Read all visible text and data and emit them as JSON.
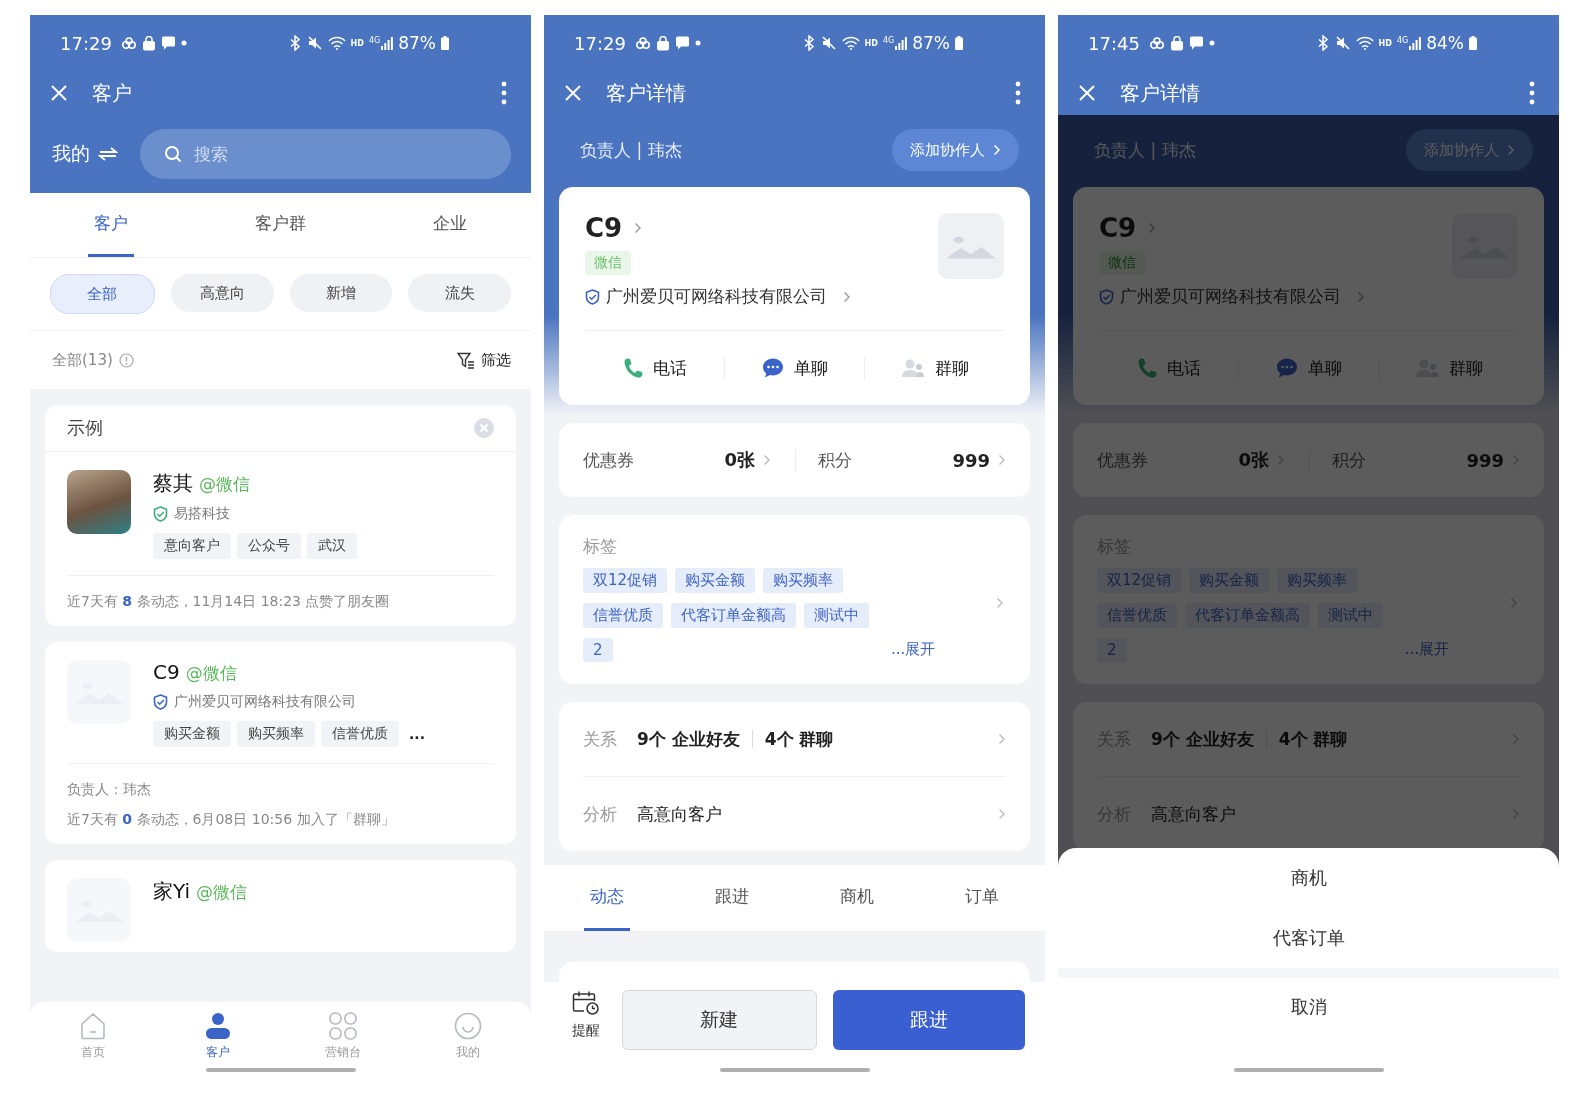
{
  "screens": [
    {
      "kind": "list",
      "status": {
        "time": "17:29",
        "network": "HD",
        "signal": "4G",
        "battery": "87%"
      },
      "title": "客户",
      "scope": "我的",
      "search": {
        "placeholder": "搜索"
      },
      "tabs": [
        {
          "label": "客户",
          "selected": true
        },
        {
          "label": "客户群",
          "selected": false
        },
        {
          "label": "企业",
          "selected": false
        }
      ],
      "chips": [
        {
          "label": "全部",
          "selected": true
        },
        {
          "label": "高意向",
          "selected": false
        },
        {
          "label": "新增",
          "selected": false
        },
        {
          "label": "流失",
          "selected": false
        }
      ],
      "summary": {
        "count": "全部(13)",
        "filter": "筛选"
      },
      "customers": [
        {
          "header": "示例",
          "kind": "photo",
          "name": "蔡其",
          "channel": "@微信",
          "company": "易搭科技",
          "color": "#3bb07c",
          "tags": [
            "意向客户",
            "公众号",
            "武汉"
          ],
          "activity": {
            "prefix": "近7天有",
            "count": "8",
            "suffix": "条动态，11月14日 18:23 点赞了朋友圈"
          }
        },
        {
          "kind": "placeholder",
          "name": "C9",
          "channel": "@微信",
          "company": "广州爱贝可网络科技有限公司",
          "color": "#3a64c8",
          "tags": [
            "购买金额",
            "购买频率",
            "信誉优质"
          ],
          "overflow": "...",
          "owner": "负责人：玮杰",
          "activity": {
            "prefix": "近7天有",
            "count": "0",
            "suffix": "条动态，6月08日 10:56  加入了「群聊」"
          }
        },
        {
          "kind": "placeholder",
          "name": "家Yi",
          "channel": "@微信"
        }
      ],
      "nav": [
        {
          "label": "首页",
          "selected": false
        },
        {
          "label": "客户",
          "selected": true
        },
        {
          "label": "营销台",
          "selected": false
        },
        {
          "label": "我的",
          "selected": false
        }
      ]
    },
    {
      "kind": "detail",
      "dimmed": false,
      "status": {
        "time": "17:29",
        "network": "HD",
        "signal": "4G",
        "battery": "87%"
      },
      "title": "客户详情",
      "owner": "负责人 | 玮杰",
      "add_button": "添加协作人",
      "customer": {
        "name": "C9",
        "channel": "微信",
        "company": "广州爱贝可网络科技有限公司"
      },
      "actions": [
        {
          "label": "电话"
        },
        {
          "label": "单聊"
        },
        {
          "label": "群聊"
        }
      ],
      "stats": [
        {
          "label": "优惠券",
          "value": "0张"
        },
        {
          "label": "积分",
          "value": "999"
        }
      ],
      "tags_title": "标签",
      "tags": [
        "双12促销",
        "购买金额",
        "购买频率",
        "信誉优质",
        "代客订单金额高",
        "测试中",
        "2"
      ],
      "expand": "...展开",
      "relation": {
        "label": "关系",
        "items": [
          "9个 企业好友",
          "4个 群聊"
        ]
      },
      "analysis": {
        "label": "分析",
        "value": "高意向客户"
      },
      "tabs": [
        {
          "label": "动态",
          "selected": true
        },
        {
          "label": "跟进",
          "selected": false
        },
        {
          "label": "商机",
          "selected": false
        },
        {
          "label": "订单",
          "selected": false
        }
      ],
      "reminder": "提醒",
      "buttons": [
        {
          "label": "新建",
          "kind": "secondary"
        },
        {
          "label": "跟进",
          "kind": "primary"
        }
      ]
    },
    {
      "kind": "detail",
      "dimmed": true,
      "status": {
        "time": "17:45",
        "network": "HD",
        "signal": "4G",
        "battery": "84%"
      },
      "title": "客户详情",
      "owner": "负责人 | 玮杰",
      "add_button": "添加协作人",
      "customer": {
        "name": "C9",
        "channel": "微信",
        "company": "广州爱贝可网络科技有限公司"
      },
      "actions": [
        {
          "label": "电话"
        },
        {
          "label": "单聊"
        },
        {
          "label": "群聊"
        }
      ],
      "stats": [
        {
          "label": "优惠券",
          "value": "0张"
        },
        {
          "label": "积分",
          "value": "999"
        }
      ],
      "tags_title": "标签",
      "tags": [
        "双12促销",
        "购买金额",
        "购买频率",
        "信誉优质",
        "代客订单金额高",
        "测试中",
        "2"
      ],
      "expand": "...展开",
      "relation": {
        "label": "关系",
        "items": [
          "9个 企业好友",
          "4个 群聊"
        ]
      },
      "analysis": {
        "label": "分析",
        "value": "高意向客户"
      },
      "sheet": {
        "options": [
          "商机",
          "代客订单"
        ],
        "cancel": "取消"
      }
    }
  ]
}
